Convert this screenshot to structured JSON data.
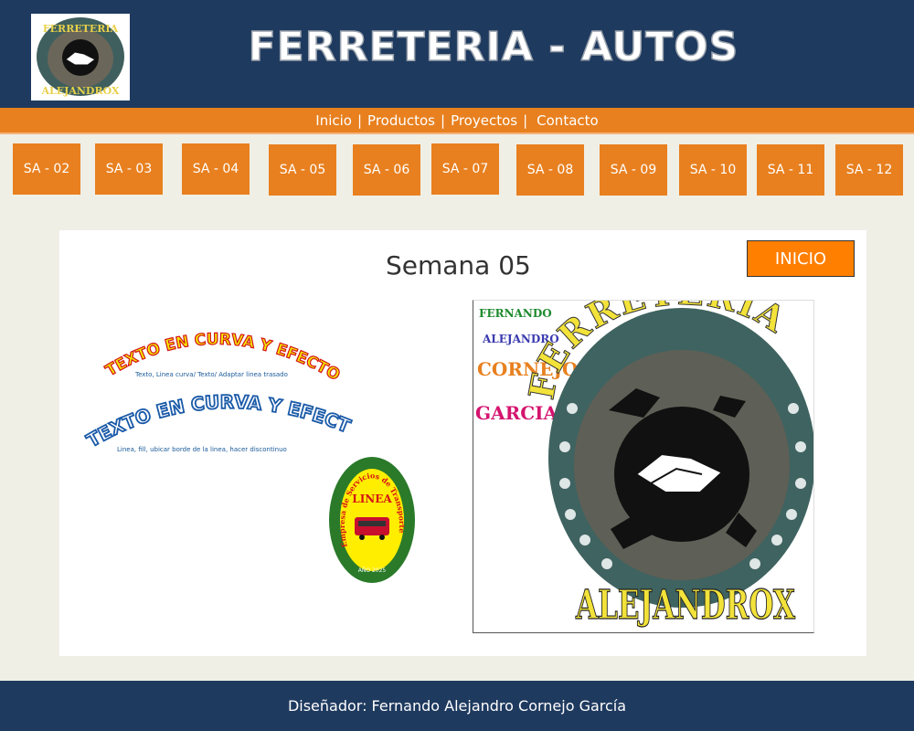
{
  "header": {
    "title": "FERRETERIA - AUTOS",
    "logo": {
      "top_text": "FERRETERIA",
      "bottom_text": "ALEJANDROX"
    }
  },
  "menu": {
    "items": [
      "Inicio",
      "Productos",
      "Proyectos",
      "Contacto"
    ],
    "separator": "|"
  },
  "weeks": [
    "SA - 02",
    "SA - 03",
    "SA - 04",
    "SA - 05",
    "SA - 06",
    "SA - 07",
    "SA - 08",
    "SA - 09",
    "SA - 10",
    "SA - 11",
    "SA - 12"
  ],
  "main": {
    "title": "Semana 05",
    "inicio_button": "INICIO",
    "curve1": {
      "heading": "TEXTO EN CURVA Y EFECTOS",
      "sub": "Texto, Linea curva/ Texto/ Adaptar linea trasado"
    },
    "curve2": {
      "heading": "TEXTO EN CURVA Y EFECTO",
      "sub": "Linea, fill, ubicar borde de la linea, hacer discontinuo"
    },
    "bus_logo": {
      "arc_text": "Empresa de Servicios de Transporte",
      "label": "LINEA",
      "year": "AÑO 2025"
    },
    "big_logo": {
      "top_text": "FERRETERÍA",
      "bottom_text": "ALEJANDROX",
      "name_words": [
        "FERNANDO",
        "ALEJANDRO",
        "CORNEJO",
        "GARCIA"
      ]
    }
  },
  "footer": {
    "text": "Diseñador: Fernando Alejandro Cornejo García"
  },
  "colors": {
    "navy": "#1f3a5f",
    "orange": "#e8801f",
    "inicio": "#ff7f00",
    "background": "#f0efe6"
  }
}
